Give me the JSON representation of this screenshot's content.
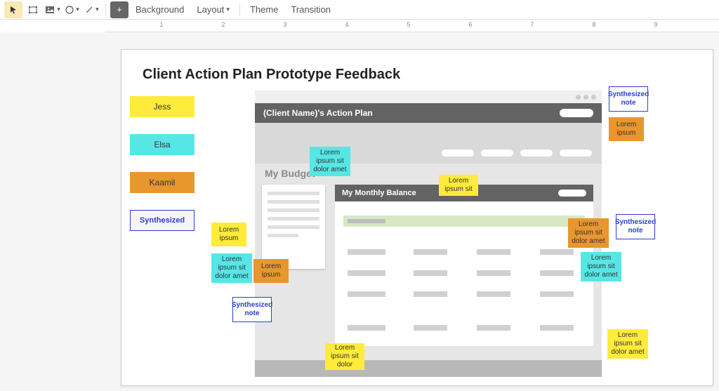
{
  "toolbar": {
    "background_label": "Background",
    "layout_label": "Layout",
    "theme_label": "Theme",
    "transition_label": "Transition"
  },
  "ruler": {
    "marks": [
      1,
      2,
      3,
      4,
      5,
      6,
      7,
      8,
      9
    ]
  },
  "slide": {
    "title": "Client Action Plan Prototype Feedback",
    "legend": {
      "jess": "Jess",
      "elsa": "Elsa",
      "kaamil": "Kaamil",
      "synthesized": "Synthesized"
    },
    "wireframe": {
      "header_title": "(Client Name)'s Action Plan",
      "budget_label": "My Budget",
      "panel_title": "My Monthly Balance"
    },
    "notes": {
      "n1": "Synthesized note",
      "n2": "Lorem ipsum",
      "n3": "Lorem ipsum sit dolor amet",
      "n4": "Lorem ipsum sit",
      "n5": "Synthesized note",
      "n6": "Lorem ipsum",
      "n7": "Lorem ipsum sit dolor amet",
      "n8": "Lorem ipsum",
      "n9": "Lorem ipsum sit dolor amet",
      "n10": "Lorem ipsum sit dolor amet",
      "n11": "Synthesized note",
      "n12": "Lorem ipsum sit dolor",
      "n13": "Lorem ipsum sit dolor amet"
    }
  }
}
